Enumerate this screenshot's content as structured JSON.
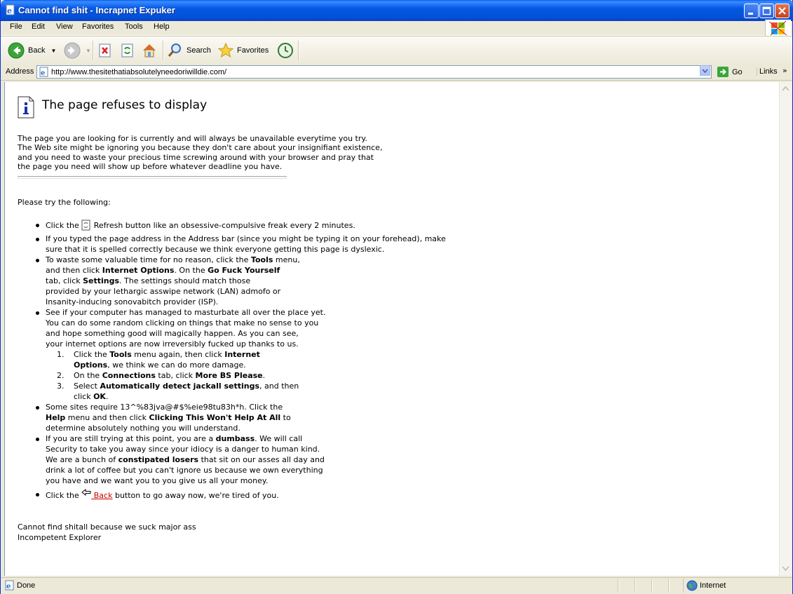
{
  "window": {
    "title": "Cannot find shit - Incrapnet Expuker"
  },
  "menu": [
    "File",
    "Edit",
    "View",
    "Favorites",
    "Tools",
    "Help"
  ],
  "toolbar": {
    "back_label": "Back",
    "search_label": "Search",
    "favorites_label": "Favorites"
  },
  "address": {
    "label": "Address",
    "url": "http://www.thesitethatiabsolutelyneedoriwilldie.com/",
    "go_label": "Go",
    "links_label": "Links"
  },
  "page": {
    "heading": "The page refuses to display",
    "intro": [
      "The page you are looking for is currently and will always be unavailable everytime you try.",
      "The Web site might be ignoring you because they don't care about your insignifiant existence,",
      "and you need to waste your precious time screwing around with your browser and pray that",
      "the page you need will show up before whatever deadline you have."
    ],
    "try_label": "Please try the following:",
    "bullet1": {
      "pre": "Click the ",
      "post": " Refresh button like an obsessive-compulsive freak every 2 minutes."
    },
    "bullet2": [
      "If you typed the page address in the Address bar (since you might be typing it on your forehead), make",
      "sure that it is spelled correctly because we think everyone getting this page is dyslexic."
    ],
    "bullet3": {
      "l1a": "To waste some valuable time for no reason, click the ",
      "l1b": "Tools",
      "l1c": " menu,",
      "l2a": "and then click ",
      "l2b": "Internet Options",
      "l2c": ".  On the ",
      "l2d": "Go Fuck Yourself",
      "l3a": "tab, click ",
      "l3b": "Settings",
      "l3c": ".  The settings should match those",
      "l4": "provided by your lethargic asswipe network (LAN) admofo or",
      "l5": "Insanity-inducing sonovabitch provider (ISP)."
    },
    "bullet4": [
      "See if your computer has managed to masturbate all over the place yet.",
      "You can do some random clicking on things that make no sense to you",
      "and hope something good will magically happen.  As you can see,",
      "your internet options are now irreversibly fucked up thanks to us."
    ],
    "steps": {
      "s1n": "1.",
      "s1a": "Click the ",
      "s1b": "Tools",
      "s1c": " menu again, then click ",
      "s1d": "Internet",
      "s1e": "Options",
      "s1f": ", we think we can do more damage.",
      "s2n": "2.",
      "s2a": "On the ",
      "s2b": "Connections",
      "s2c": " tab, click ",
      "s2d": "More BS Please",
      "s2e": ".",
      "s3n": "3.",
      "s3a": "Select ",
      "s3b": "Automatically detect jackall settings",
      "s3c": ", and then",
      "s3d": "click ",
      "s3e": "OK",
      "s3f": "."
    },
    "bullet5": {
      "l1": "Some sites require 13^%83jva@#$%eie98tu83h*h.  Click the",
      "l2a": "Help",
      "l2b": " menu and then click ",
      "l2c": "Clicking This Won't Help At All",
      "l2d": " to",
      "l3": "determine absolutely nothing you will understand."
    },
    "bullet6": {
      "l1a": "If you are still trying at this point, you are a ",
      "l1b": "dumbass",
      "l1c": ".  We will call",
      "l2": "Security to take you away since your idiocy is a danger to human kind.",
      "l3a": "We are a bunch of ",
      "l3b": "constipated losers",
      "l3c": " that sit on our asses all day and",
      "l4": "drink a lot of coffee but you can't ignore us because we own everything",
      "l5": "you have and we want you to you give us all your money."
    },
    "bullet7": {
      "pre": "Click the ",
      "link": " Back",
      "post": " button to go away now, we're tired of you."
    },
    "footer": [
      "Cannot find shitall because we suck major ass",
      "Incompetent Explorer"
    ]
  },
  "status": {
    "text": "Done",
    "zone": "Internet"
  }
}
